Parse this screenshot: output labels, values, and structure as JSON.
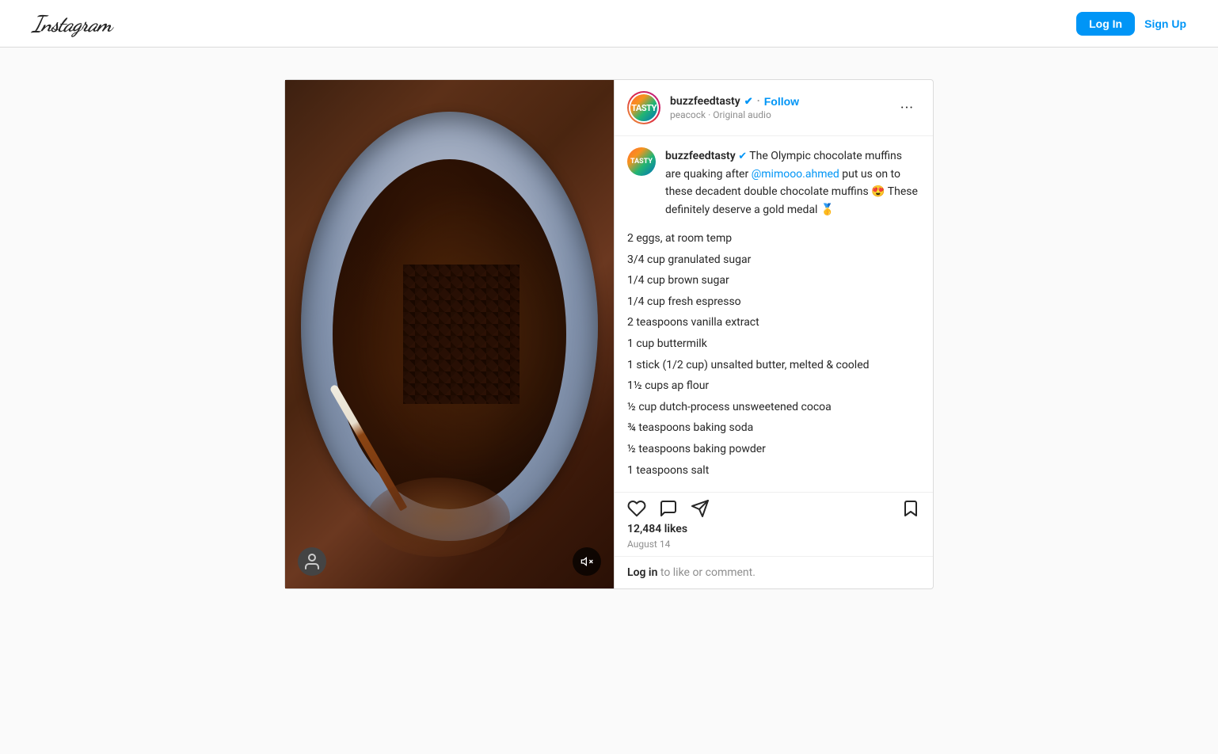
{
  "header": {
    "logo": "Instagram",
    "login_label": "Log In",
    "signup_label": "Sign Up"
  },
  "post": {
    "user": {
      "username": "buzzfeedtasty",
      "verified": true,
      "avatar_text": "TASTY",
      "subtitle": "peacock · Original audio"
    },
    "follow_label": "Follow",
    "more_options_label": "···",
    "caption": {
      "username": "buzzfeedtasty",
      "verified": true,
      "text": " The Olympic chocolate muffins are quaking after ",
      "mention": "@mimooo.ahmed",
      "text2": " put us on to these decadent double chocolate muffins 😍 These definitely deserve a gold medal 🥇"
    },
    "recipe": {
      "ingredients": [
        "2 eggs, at room temp",
        "3/4 cup granulated sugar",
        "1/4 cup brown sugar",
        "1/4 cup fresh espresso",
        "2 teaspoons vanilla extract",
        "1 cup buttermilk",
        "1 stick (1/2 cup) unsalted butter, melted & cooled",
        "1½ cups ap flour",
        "½ cup dutch-process unsweetened cocoa",
        "¾ teaspoons baking soda",
        "½ teaspoons baking powder",
        "1 teaspoons salt"
      ]
    },
    "likes": "12,484 likes",
    "date": "August 14",
    "login_prompt": "to like or comment.",
    "login_link_text": "Log in"
  }
}
